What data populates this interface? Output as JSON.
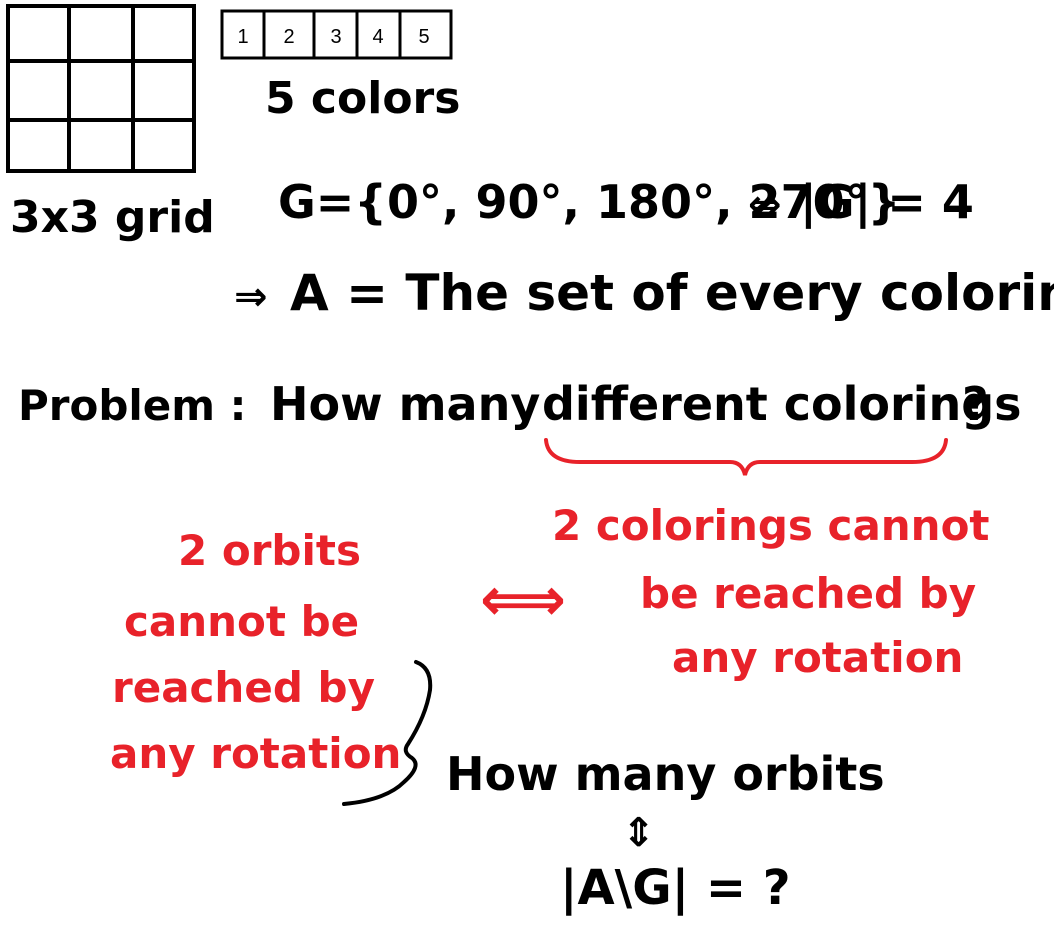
{
  "grid": {
    "rows": 3,
    "cols": 3,
    "label": "3x3 grid"
  },
  "palette": {
    "cells": [
      "1",
      "2",
      "3",
      "4",
      "5"
    ],
    "label": "5 colors"
  },
  "group": {
    "lhs": "G={0°, 90°, 180°, 270°}",
    "iff": "⇔",
    "order": "|G| = 4"
  },
  "set_a": {
    "implies": "⇒",
    "text": "A = The set of every coloring"
  },
  "problem": {
    "prefix": "Problem :",
    "question_start": "How many",
    "underlined": "different colorings",
    "question_end": "?"
  },
  "left_note": {
    "lines": [
      "2 orbits",
      "cannot be",
      "reached by",
      "any rotation"
    ]
  },
  "right_note": {
    "lines": [
      "2 colorings cannot",
      "be reached by",
      "any rotation"
    ]
  },
  "equiv_arrow": "⟺",
  "orbits": {
    "question": "How many orbits",
    "down_equiv": "⇕",
    "formula": "|A\\G| = ?"
  },
  "colors": {
    "ink": "#000000",
    "red": "#e8222a"
  }
}
